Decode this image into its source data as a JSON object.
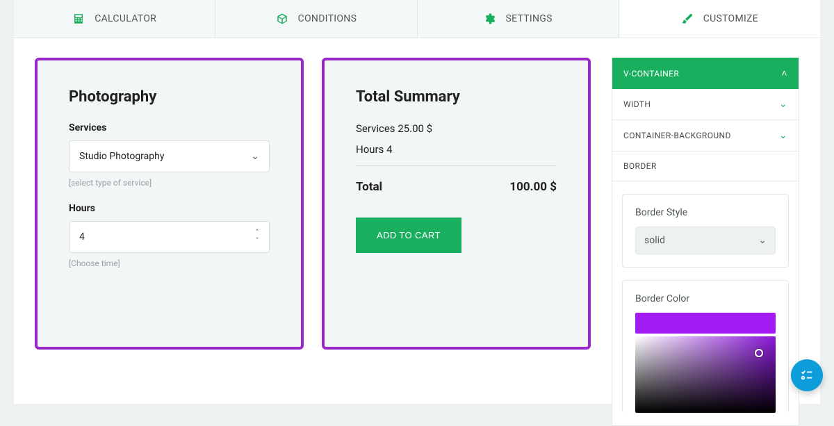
{
  "tabs": {
    "calculator": "CALCULATOR",
    "conditions": "CONDITIONS",
    "settings": "SETTINGS",
    "customize": "CUSTOMIZE"
  },
  "form": {
    "title": "Photography",
    "services_label": "Services",
    "services_value": "Studio Photography",
    "services_hint": "[select type of service]",
    "hours_label": "Hours",
    "hours_value": "4",
    "hours_hint": "[Choose time]"
  },
  "summary": {
    "title": "Total Summary",
    "line_services": "Services 25.00 $",
    "line_hours": "Hours 4",
    "total_label": "Total",
    "total_value": "100.00 $",
    "add_to_cart": "ADD TO CART"
  },
  "side": {
    "vcontainer": "V-CONTAINER",
    "width": "WIDTH",
    "container_bg": "CONTAINER-BACKGROUND",
    "border": "BORDER",
    "border_style_label": "Border Style",
    "border_style_value": "solid",
    "border_color_label": "Border Color",
    "accent": "#9a27c7",
    "hue": "#a31cf3"
  }
}
